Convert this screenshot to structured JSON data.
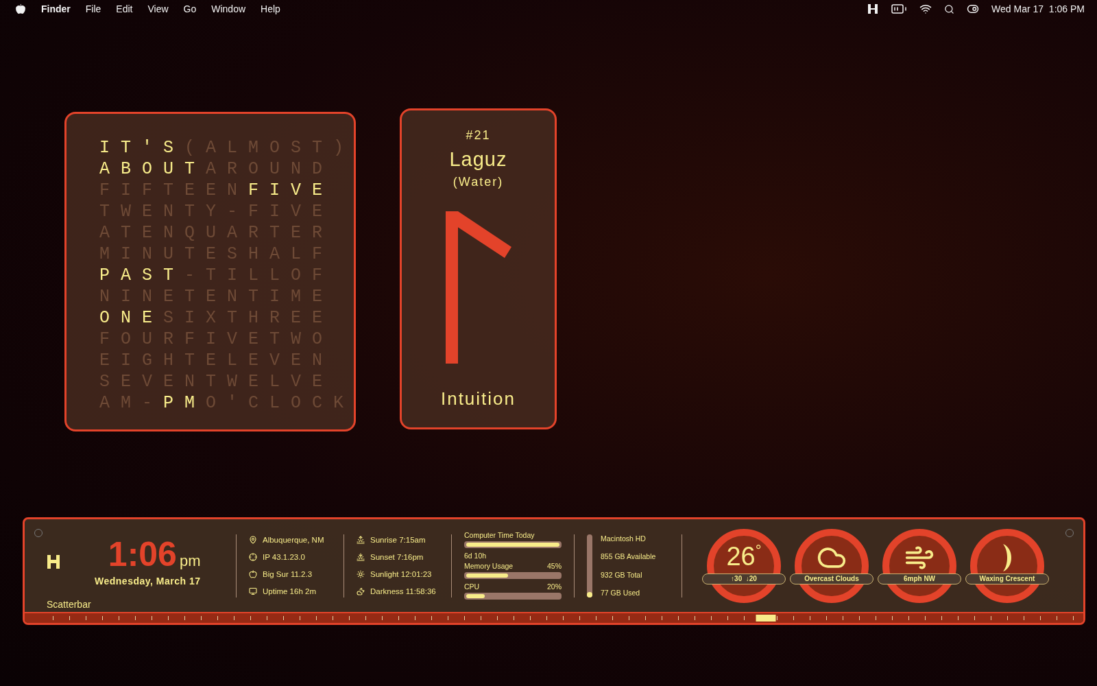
{
  "menubar": {
    "app_name": "Finder",
    "menus": [
      "File",
      "Edit",
      "View",
      "Go",
      "Window",
      "Help"
    ],
    "clock": "Wed Mar 17  1:06 PM"
  },
  "word_clock": {
    "rows": [
      [
        {
          "text": "IT'S",
          "lit": true
        },
        {
          "text": "(ALMOST)",
          "lit": false
        }
      ],
      [
        {
          "text": "ABOUT",
          "lit": true
        },
        {
          "text": "AROUND",
          "lit": false
        }
      ],
      [
        {
          "text": "FIFTEEN",
          "lit": false
        },
        {
          "text": "FIVE",
          "lit": true
        }
      ],
      [
        {
          "text": "TWENTY-FIVE",
          "lit": false
        }
      ],
      [
        {
          "text": "ATENQUARTER",
          "lit": false
        }
      ],
      [
        {
          "text": "MINUTESHALF",
          "lit": false
        }
      ],
      [
        {
          "text": "PAST",
          "lit": true
        },
        {
          "text": "-TILLOF",
          "lit": false
        }
      ],
      [
        {
          "text": "NINETENTIME",
          "lit": false
        }
      ],
      [
        {
          "text": "ONE",
          "lit": true
        },
        {
          "text": "SIXTHREE",
          "lit": false
        }
      ],
      [
        {
          "text": "FOURFIVETWO",
          "lit": false
        }
      ],
      [
        {
          "text": "EIGHTELEVEN",
          "lit": false
        }
      ],
      [
        {
          "text": "SEVENTWELVE",
          "lit": false
        }
      ],
      [
        {
          "text": "AM-",
          "lit": false
        },
        {
          "text": "PM",
          "lit": true
        },
        {
          "text": "O'CLOCK",
          "lit": false
        }
      ]
    ]
  },
  "rune_card": {
    "number": "#21",
    "name": "Laguz",
    "meaning": "(Water)",
    "keyword": "Intuition"
  },
  "scatterbar": {
    "title": "Scatterbar",
    "time": "1:06",
    "meridiem": "pm",
    "date": "Wednesday, March 17",
    "system_info": [
      {
        "kind": "location",
        "text": "Albuquerque, NM"
      },
      {
        "kind": "network",
        "text": "IP 43.1.23.0"
      },
      {
        "kind": "os",
        "text": "Big Sur 11.2.3"
      },
      {
        "kind": "uptime",
        "text": "Uptime 16h 2m"
      }
    ],
    "sun_info": [
      {
        "kind": "sunrise",
        "text": "Sunrise 7:15am"
      },
      {
        "kind": "sunset",
        "text": "Sunset 7:16pm"
      },
      {
        "kind": "sunlight",
        "text": "Sunlight 12:01:23"
      },
      {
        "kind": "darkness",
        "text": "Darkness 11:58:36"
      }
    ],
    "usage": [
      {
        "kind": "time",
        "label": "Computer Time Today",
        "reading": "6d 10h",
        "level": 1.0
      },
      {
        "kind": "percent",
        "label": "Memory Usage",
        "reading": "45%",
        "level": 0.45
      },
      {
        "kind": "percent",
        "label": "CPU",
        "reading": "20%",
        "level": 0.2
      }
    ],
    "disk": {
      "name": "Macintosh HD",
      "available": "855 GB Available",
      "total": "932 GB Total",
      "used": "77 GB Used",
      "level": 0.08
    },
    "weather": [
      {
        "kind": "temperature",
        "value": "26$^{°}$",
        "caption": "↑30  ↓20"
      },
      {
        "kind": "cloud",
        "caption": "Overcast Clouds"
      },
      {
        "kind": "wind",
        "caption": "6mph NW"
      },
      {
        "kind": "moon",
        "caption": "Waxing Crescent"
      }
    ],
    "timeline": {
      "level": 0.7
    }
  }
}
